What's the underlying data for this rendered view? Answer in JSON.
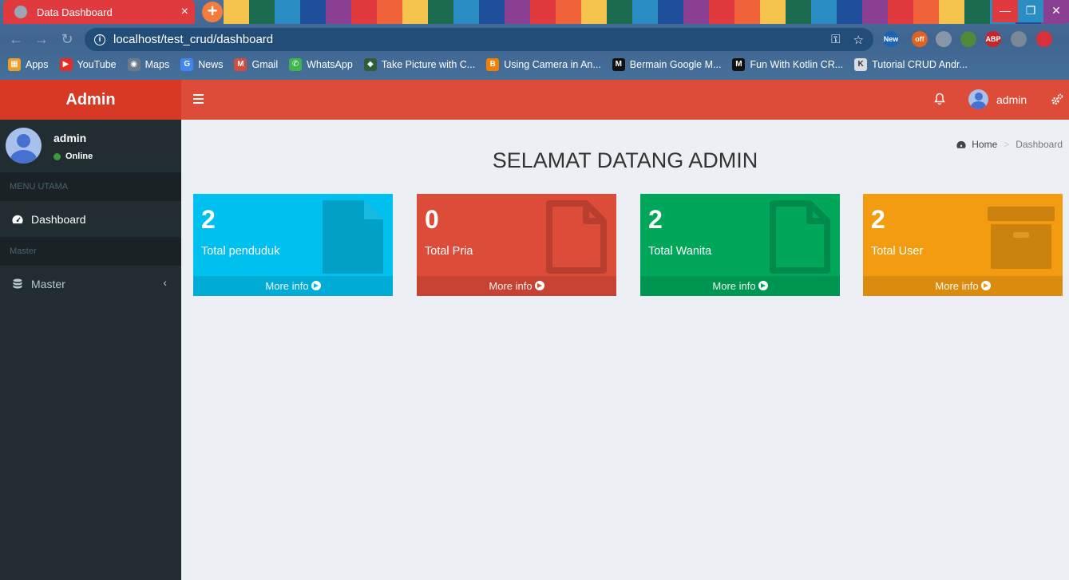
{
  "browser": {
    "tab_title": "Data Dashboard",
    "tab_close": "×",
    "new_tab": "+",
    "url": "localhost/test_crud/dashboard",
    "window_controls": {
      "minimize": "—",
      "maximize": "❐",
      "close": "✕"
    },
    "extensions": [
      {
        "name": "extension-new",
        "label": "New",
        "color": "#1a63b5"
      },
      {
        "name": "extension-off",
        "label": "off",
        "color": "#e2621f"
      },
      {
        "name": "extension-globe",
        "label": "",
        "color": "#8896a8"
      },
      {
        "name": "extension-planet",
        "label": "",
        "color": "#4f8a3a"
      },
      {
        "name": "extension-abp",
        "label": "ABP",
        "color": "#c7242b"
      },
      {
        "name": "extension-puzzle",
        "label": "",
        "color": "#7a8796"
      },
      {
        "name": "profile-avatar",
        "label": "",
        "color": "#d8313b"
      }
    ],
    "bookmarks": [
      {
        "label": "Apps",
        "icon": "apps-icon",
        "color": "#e8a02b"
      },
      {
        "label": "YouTube",
        "icon": "youtube-icon",
        "color": "#e52d27"
      },
      {
        "label": "Maps",
        "icon": "maps-icon",
        "color": "#6b7a8a"
      },
      {
        "label": "News",
        "icon": "news-icon",
        "color": "#4285f4"
      },
      {
        "label": "Gmail",
        "icon": "gmail-icon",
        "color": "#d54b3d"
      },
      {
        "label": "WhatsApp",
        "icon": "whatsapp-icon",
        "color": "#3fb34f"
      },
      {
        "label": "Take Picture with C...",
        "icon": "android-icon",
        "color": "#2f5d3a"
      },
      {
        "label": "Using Camera in An...",
        "icon": "blogger-icon",
        "color": "#f57d00"
      },
      {
        "label": "Bermain Google M...",
        "icon": "medium-icon",
        "color": "#111111"
      },
      {
        "label": "Fun With Kotlin CR...",
        "icon": "medium-icon",
        "color": "#111111"
      },
      {
        "label": "Tutorial CRUD Andr...",
        "icon": "k-icon",
        "color": "#d9dde2"
      }
    ]
  },
  "app": {
    "brand": "Admin",
    "user": {
      "name": "admin",
      "status": "Online"
    },
    "sidebar": {
      "header_main": "MENU UTAMA",
      "dashboard_label": "Dashboard",
      "header_master": "Master",
      "master_label": "Master",
      "master_chevron": "‹"
    },
    "topbar": {
      "username": "admin"
    },
    "breadcrumb": {
      "home": "Home",
      "separator": ">",
      "current": "Dashboard"
    },
    "title": "SELAMAT DATANG ADMIN",
    "boxes": [
      {
        "value": "2",
        "label": "Total penduduk",
        "footer": "More info",
        "color": "#00c0ef",
        "icon": "file-icon"
      },
      {
        "value": "0",
        "label": "Total Pria",
        "footer": "More info",
        "color": "#dd4b39",
        "icon": "file-outline-icon"
      },
      {
        "value": "2",
        "label": "Total Wanita",
        "footer": "More info",
        "color": "#00a65a",
        "icon": "file-outline-icon"
      },
      {
        "value": "2",
        "label": "Total User",
        "footer": "More info",
        "color": "#f39c12",
        "icon": "archive-icon"
      }
    ]
  }
}
